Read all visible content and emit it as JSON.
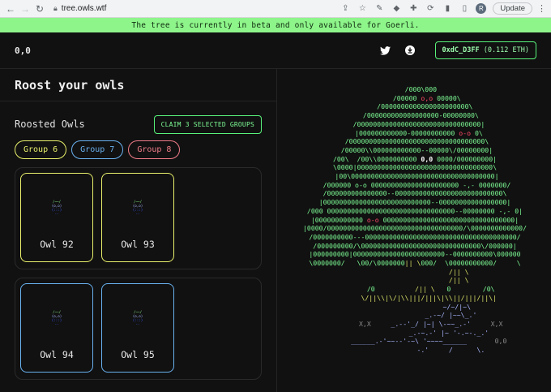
{
  "browser": {
    "url": "tree.owls.wtf",
    "update_label": "Update",
    "profile_initial": "R"
  },
  "banner": {
    "text": "The tree is currently in beta and only available for Goerli."
  },
  "header": {
    "coordinate": "0,0",
    "wallet_address": "0xdC_D3FF",
    "wallet_balance": "(0.112 ETH)"
  },
  "roost": {
    "title": "Roost your owls",
    "roosted_title": "Roosted Owls",
    "claim_button": "CLAIM 3 SELECTED GROUPS",
    "groups": [
      {
        "label": "Group 6",
        "color": "#e9f06b"
      },
      {
        "label": "Group 7",
        "color": "#6ab2f0"
      },
      {
        "label": "Group 8",
        "color": "#f07c88"
      }
    ],
    "owl_groups": [
      {
        "color": "#e9f06b",
        "owls": [
          {
            "name": "Owl 92"
          },
          {
            "name": "Owl 93"
          }
        ]
      },
      {
        "color": "#6ab2f0",
        "owls": [
          {
            "name": "Owl 94"
          },
          {
            "name": "Owl 95"
          }
        ]
      }
    ]
  },
  "tree": {
    "accent": "#7dfc95",
    "highlight_text": "0,0",
    "corner_left": "X,X",
    "corner_right": "0,0"
  },
  "colors": {
    "accent_green": "#58f27a",
    "banner": "#8ef58a",
    "background": "#111111"
  }
}
